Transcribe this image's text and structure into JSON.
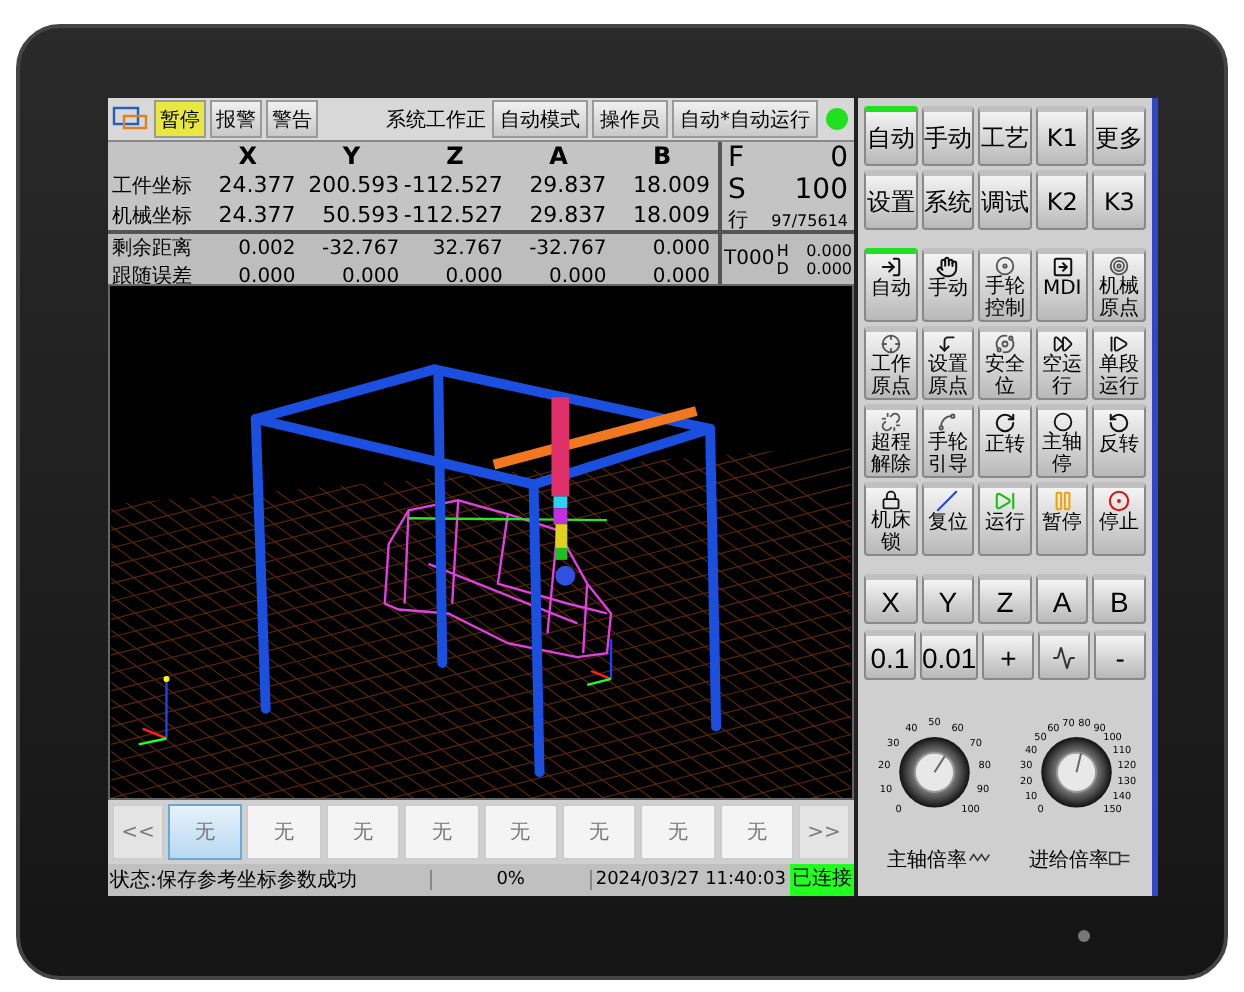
{
  "toolbar": {
    "tabs": [
      {
        "label": "暂停",
        "selected": true
      },
      {
        "label": "报警",
        "selected": false
      },
      {
        "label": "警告",
        "selected": false
      }
    ],
    "status_text": "系统工作正",
    "buttons": [
      "自动模式",
      "操作员",
      "自动*自动运行"
    ],
    "connected": true
  },
  "axes": [
    "X",
    "Y",
    "Z",
    "A",
    "B"
  ],
  "coord_rows": [
    {
      "label": "工件坐标",
      "values": [
        "24.377",
        "200.593",
        "-112.527",
        "29.837",
        "18.009"
      ]
    },
    {
      "label": "机械坐标",
      "values": [
        "24.377",
        "50.593",
        "-112.527",
        "29.837",
        "18.009"
      ]
    }
  ],
  "error_rows": [
    {
      "label": "剩余距离",
      "values": [
        "0.002",
        "-32.767",
        "32.767",
        "-32.767",
        "0.000"
      ]
    },
    {
      "label": "跟随误差",
      "values": [
        "0.000",
        "0.000",
        "0.000",
        "0.000",
        "0.000"
      ]
    }
  ],
  "feed": {
    "f_label": "F",
    "f_value": "0",
    "s_label": "S",
    "s_value": "100",
    "line_label": "行",
    "line_value": "97/75614"
  },
  "tool": {
    "name": "T000",
    "h_label": "H",
    "h_value": "0.000",
    "d_label": "D",
    "d_value": "0.000"
  },
  "page_bar": {
    "prev": "<<",
    "next": ">>",
    "slots": [
      {
        "label": "无",
        "selected": true
      },
      {
        "label": "无",
        "selected": false
      },
      {
        "label": "无",
        "selected": false
      },
      {
        "label": "无",
        "selected": false
      },
      {
        "label": "无",
        "selected": false
      },
      {
        "label": "无",
        "selected": false
      },
      {
        "label": "无",
        "selected": false
      },
      {
        "label": "无",
        "selected": false
      }
    ]
  },
  "status_bar": {
    "message": "状态:保存参考坐标参数成功",
    "progress": "0%",
    "datetime": "2024/03/27 11:40:03",
    "connection": "已连接"
  },
  "mode_keys": [
    {
      "label": "自动",
      "selected": true
    },
    {
      "label": "手动",
      "selected": false
    },
    {
      "label": "工艺",
      "selected": false
    },
    {
      "label": "K1",
      "selected": false
    },
    {
      "label": "更多",
      "selected": false
    },
    {
      "label": "设置",
      "selected": false
    },
    {
      "label": "系统",
      "selected": false
    },
    {
      "label": "调试",
      "selected": false
    },
    {
      "label": "K2",
      "selected": false
    },
    {
      "label": "K3",
      "selected": false
    }
  ],
  "function_keys": [
    {
      "label": "自动",
      "selected": true
    },
    {
      "label": "手动",
      "selected": false
    },
    {
      "label": "手轮控制",
      "selected": false
    },
    {
      "label": "MDI",
      "selected": false
    },
    {
      "label": "机械原点",
      "selected": false
    },
    {
      "label": "工作原点",
      "selected": false
    },
    {
      "label": "设置原点",
      "selected": false
    },
    {
      "label": "安全位",
      "selected": false
    },
    {
      "label": "空运行",
      "selected": false
    },
    {
      "label": "单段运行",
      "selected": false
    },
    {
      "label": "超程解除",
      "selected": false
    },
    {
      "label": "手轮引导",
      "selected": false
    },
    {
      "label": "正转",
      "selected": false
    },
    {
      "label": "主轴停",
      "selected": false
    },
    {
      "label": "反转",
      "selected": false
    },
    {
      "label": "机床锁",
      "selected": false
    },
    {
      "label": "复位",
      "selected": false
    },
    {
      "label": "运行",
      "selected": false
    },
    {
      "label": "暂停",
      "selected": false
    },
    {
      "label": "停止",
      "selected": false
    }
  ],
  "axis_keys": [
    "X",
    "Y",
    "Z",
    "A",
    "B"
  ],
  "step_keys": [
    {
      "kind": "text",
      "label": "0.1"
    },
    {
      "kind": "text",
      "label": "0.01"
    },
    {
      "kind": "text",
      "label": "+"
    },
    {
      "kind": "icon"
    },
    {
      "kind": "text",
      "label": "-"
    }
  ],
  "knobs": [
    {
      "label": "主轴倍率",
      "level": 0.62,
      "scale": [
        "0",
        "10",
        "20",
        "30",
        "40",
        "50",
        "60",
        "70",
        "80",
        "90",
        "100"
      ]
    },
    {
      "label": "进给倍率",
      "level": 0.55,
      "scale": [
        "0",
        "10",
        "20",
        "30",
        "40",
        "50",
        "60",
        "70",
        "80",
        "90",
        "100",
        "110",
        "120",
        "130",
        "140",
        "150"
      ]
    }
  ]
}
